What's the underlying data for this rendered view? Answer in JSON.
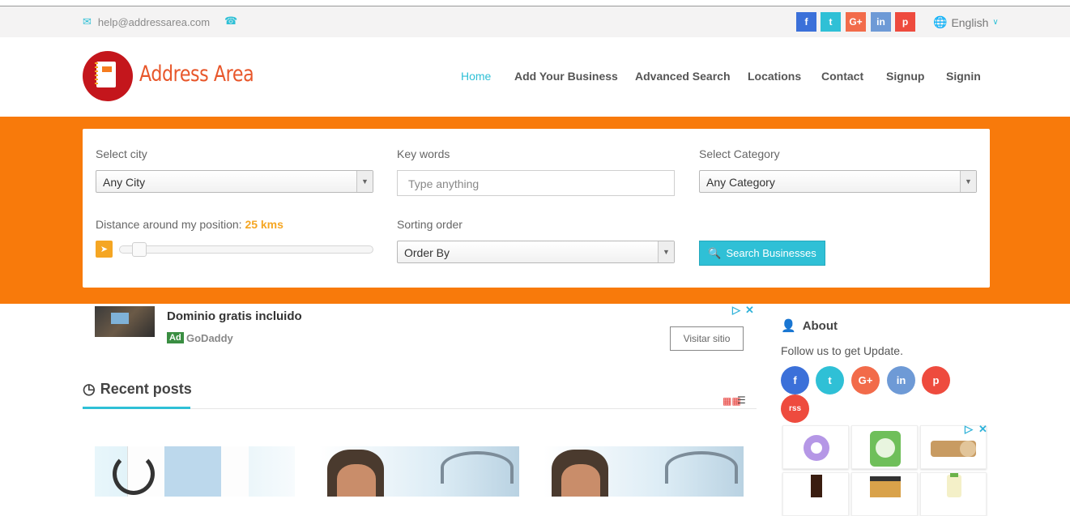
{
  "topbar": {
    "email": "help@addressarea.com",
    "language": "English",
    "social": [
      {
        "name": "facebook",
        "glyph": "f",
        "color": "#3b70d9"
      },
      {
        "name": "twitter",
        "glyph": "t",
        "color": "#2fc0d6"
      },
      {
        "name": "google-plus",
        "glyph": "G+",
        "color": "#f26b4a"
      },
      {
        "name": "linkedin",
        "glyph": "in",
        "color": "#6e9ad6"
      },
      {
        "name": "pinterest",
        "glyph": "p",
        "color": "#ee4b3e"
      }
    ]
  },
  "header": {
    "brand": "Address Area",
    "nav": [
      "Home",
      "Add Your Business",
      "Advanced Search",
      "Locations",
      "Contact",
      "Signup",
      "Signin"
    ],
    "active_nav": "Home"
  },
  "search": {
    "city_label": "Select city",
    "city_value": "Any City",
    "keywords_label": "Key words",
    "keywords_placeholder": "Type anything",
    "category_label": "Select Category",
    "category_value": "Any Category",
    "distance_label": "Distance around my position:",
    "distance_value": "25 kms",
    "distance_fraction": 0.05,
    "sort_label": "Sorting order",
    "sort_value": "Order By",
    "button_label": "Search Businesses"
  },
  "ad_top": {
    "headline": "Dominio gratis incluido",
    "ad_badge": "Ad",
    "advertiser": "GoDaddy",
    "cta": "Visitar sitio"
  },
  "recent": {
    "title": "Recent posts"
  },
  "about": {
    "title": "About",
    "text": "Follow us to get Update.",
    "social": [
      {
        "name": "facebook",
        "glyph": "f",
        "color": "#3b70d9"
      },
      {
        "name": "twitter",
        "glyph": "t",
        "color": "#2fc0d6"
      },
      {
        "name": "google-plus",
        "glyph": "G+",
        "color": "#f26b4a"
      },
      {
        "name": "linkedin",
        "glyph": "in",
        "color": "#6e9ad6"
      },
      {
        "name": "pinterest",
        "glyph": "p",
        "color": "#ee4b3e"
      },
      {
        "name": "rss",
        "glyph": "rss",
        "color": "#ee4b3e"
      }
    ]
  },
  "colors": {
    "accent": "#2fc0d6",
    "hero_orange": "#f87a0b",
    "brand_red": "#e8572b",
    "distance_orange": "#f5a623"
  }
}
